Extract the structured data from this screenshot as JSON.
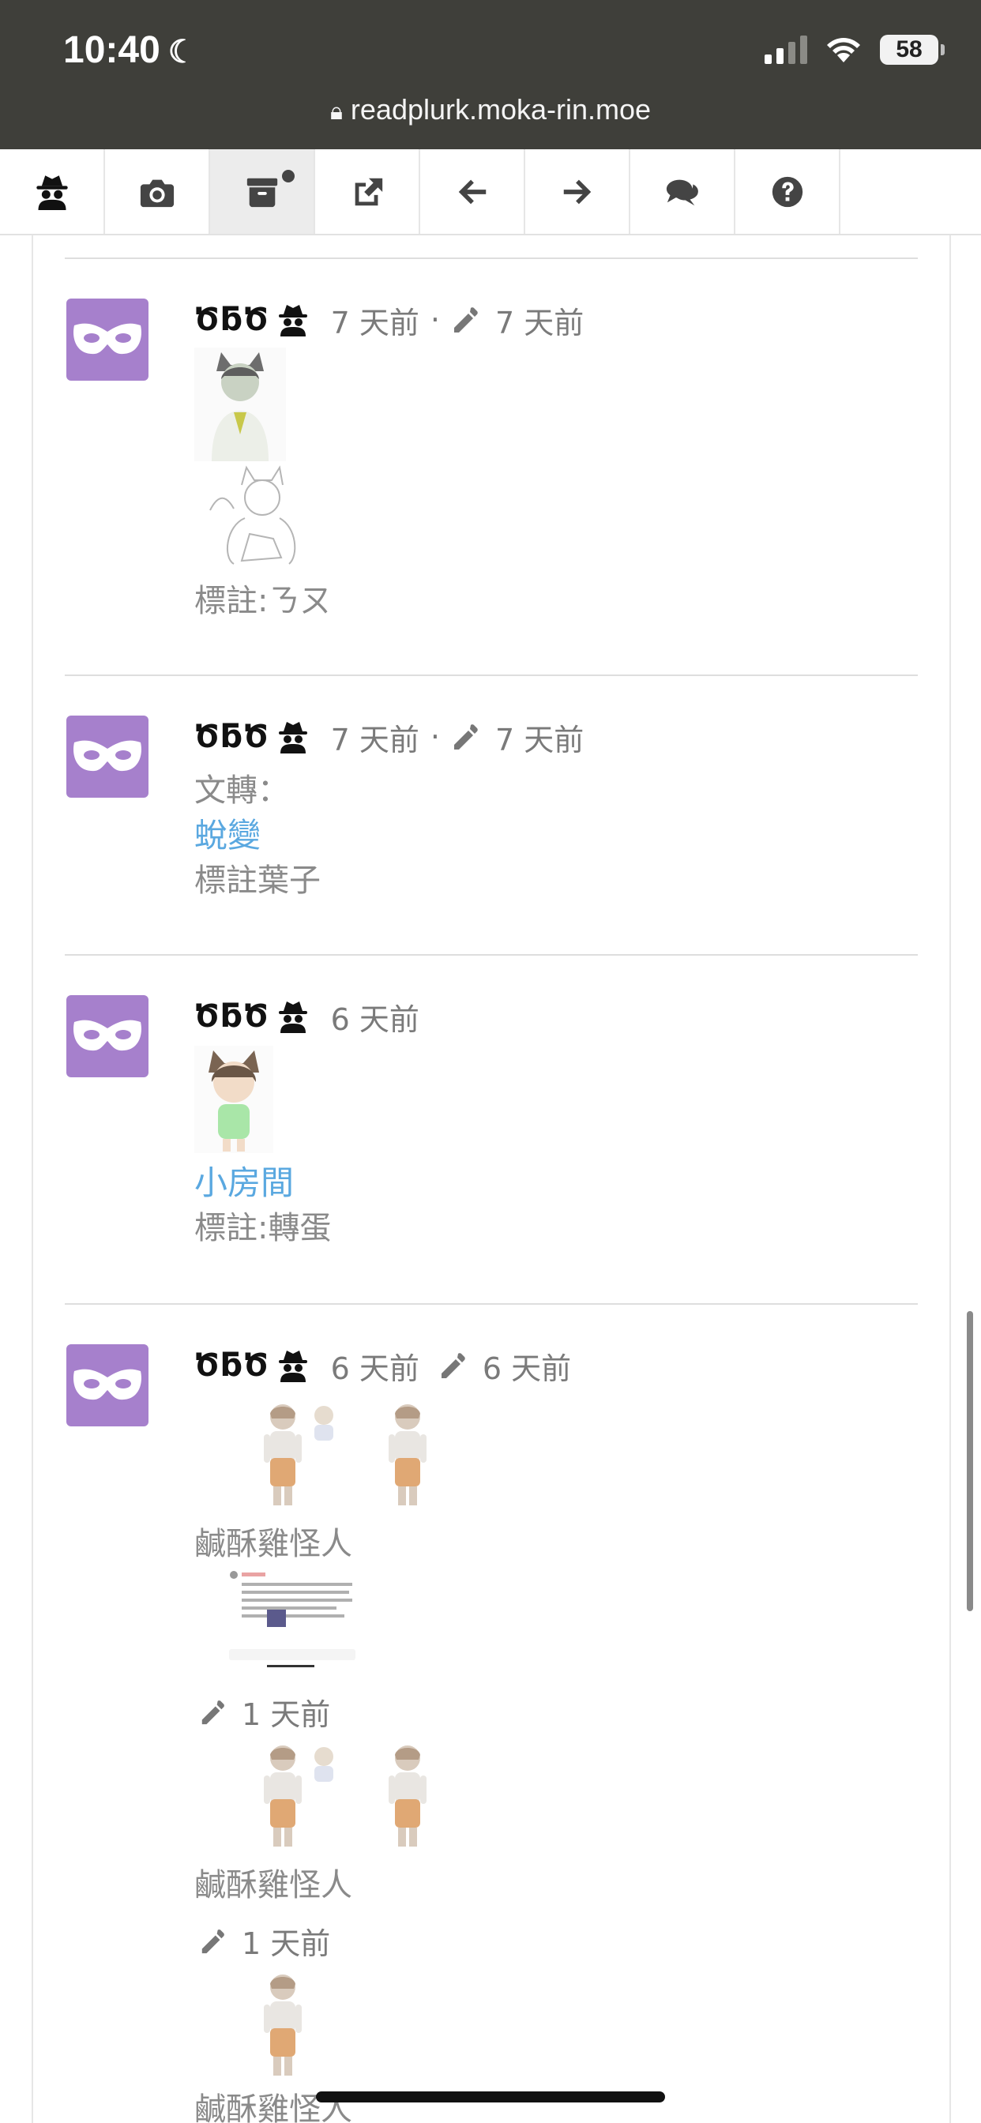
{
  "status_bar": {
    "time": "10:40",
    "battery": "58"
  },
  "url": "readplurk.moka-rin.moe",
  "toolbar": {
    "items": [
      {
        "icon": "spy-icon"
      },
      {
        "icon": "camera-icon"
      },
      {
        "icon": "archive-icon",
        "active": true
      },
      {
        "icon": "external-link-icon"
      },
      {
        "icon": "arrow-left-icon"
      },
      {
        "icon": "arrow-right-icon"
      },
      {
        "icon": "comments-icon"
      },
      {
        "icon": "question-icon"
      }
    ]
  },
  "posts": [
    {
      "user": "ԾƃԾ",
      "time": "7 天前",
      "separator": "·",
      "edited": "7 天前",
      "caption": "標註:ㄋㄡ"
    },
    {
      "user": "ԾƃԾ",
      "time": "7 天前",
      "separator": "·",
      "edited": "7 天前",
      "line1": "文轉：",
      "link": "蛻變",
      "line3": "標註葉子"
    },
    {
      "user": "ԾƃԾ",
      "time": "6 天前",
      "link": "小房間",
      "caption": "標註:轉蛋"
    },
    {
      "user": "ԾƃԾ",
      "time": "6 天前",
      "edited": "6 天前",
      "caption1": "鹹酥雞怪人",
      "edit2": "1 天前",
      "caption2": "鹹酥雞怪人",
      "edit3": "1 天前",
      "caption3": "鹹酥雞怪人"
    }
  ],
  "colors": {
    "avatar_bg": "#a680cc",
    "link": "#5aa8e0",
    "topbar": "#3f3f3a"
  }
}
